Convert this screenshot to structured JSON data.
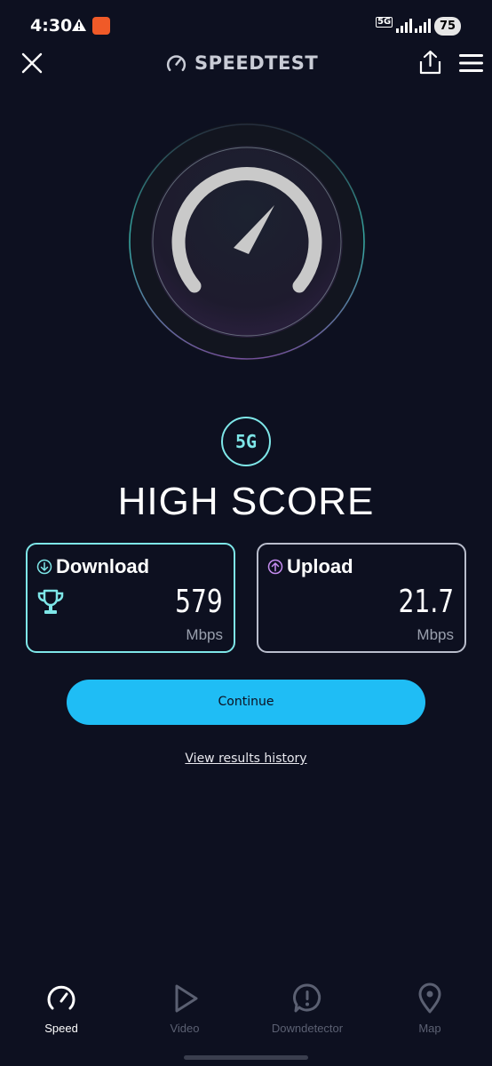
{
  "status_bar": {
    "time": "4:30",
    "network": "5G",
    "battery": "75"
  },
  "header": {
    "title": "SPEEDTEST"
  },
  "result": {
    "network_badge": "5G",
    "headline": "HIGH SCORE",
    "download": {
      "label": "Download",
      "value": "579",
      "unit": "Mbps"
    },
    "upload": {
      "label": "Upload",
      "value": "21.7",
      "unit": "Mbps"
    }
  },
  "actions": {
    "continue_label": "Continue",
    "history_label": "View results history"
  },
  "bottom_nav": {
    "items": [
      {
        "label": "Speed",
        "icon": "speed-icon",
        "active": true
      },
      {
        "label": "Video",
        "icon": "play-icon",
        "active": false
      },
      {
        "label": "Downdetector",
        "icon": "alert-icon",
        "active": false
      },
      {
        "label": "Map",
        "icon": "map-pin-icon",
        "active": false
      }
    ]
  },
  "colors": {
    "background": "#0d1020",
    "accent_teal": "#7ee6e8",
    "accent_blue": "#1fbdf5",
    "upload_purple": "#c58cf0"
  }
}
